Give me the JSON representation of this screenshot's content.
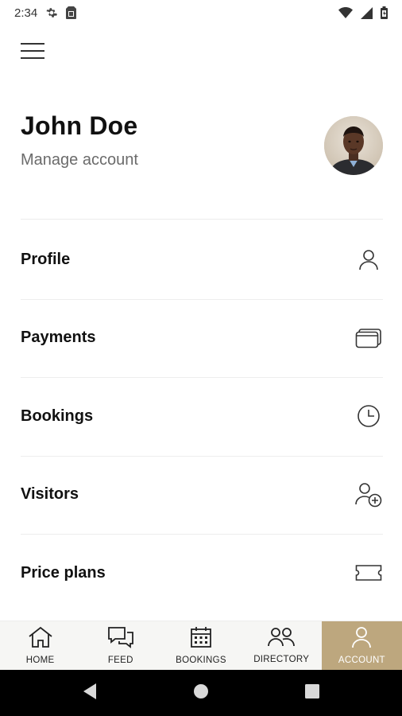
{
  "status_bar": {
    "time": "2:34",
    "left_icons": [
      "settings-icon",
      "sim-card-icon"
    ],
    "right_icons": [
      "wifi-icon",
      "signal-icon",
      "battery-icon"
    ]
  },
  "header": {
    "menu_icon": "hamburger-menu-icon",
    "user_name": "John Doe",
    "manage_account_label": "Manage account",
    "avatar_icon": "avatar-photo"
  },
  "menu": {
    "items": [
      {
        "label": "Profile",
        "icon": "person-icon"
      },
      {
        "label": "Payments",
        "icon": "cards-icon"
      },
      {
        "label": "Bookings",
        "icon": "clock-icon"
      },
      {
        "label": "Visitors",
        "icon": "person-add-icon"
      },
      {
        "label": "Price plans",
        "icon": "ticket-icon"
      }
    ]
  },
  "tabs": {
    "active": "ACCOUNT",
    "items": [
      {
        "label": "HOME",
        "icon": "home-icon"
      },
      {
        "label": "FEED",
        "icon": "chat-bubbles-icon"
      },
      {
        "label": "BOOKINGS",
        "icon": "calendar-icon"
      },
      {
        "label": "DIRECTORY",
        "icon": "people-icon"
      },
      {
        "label": "ACCOUNT",
        "icon": "person-icon"
      }
    ]
  },
  "colors": {
    "accent": "#bda77e",
    "tab_bar_bg": "#f6f6f4",
    "text_primary": "#111111",
    "text_secondary": "#6b6b6b",
    "system_nav_bg": "#000000"
  }
}
